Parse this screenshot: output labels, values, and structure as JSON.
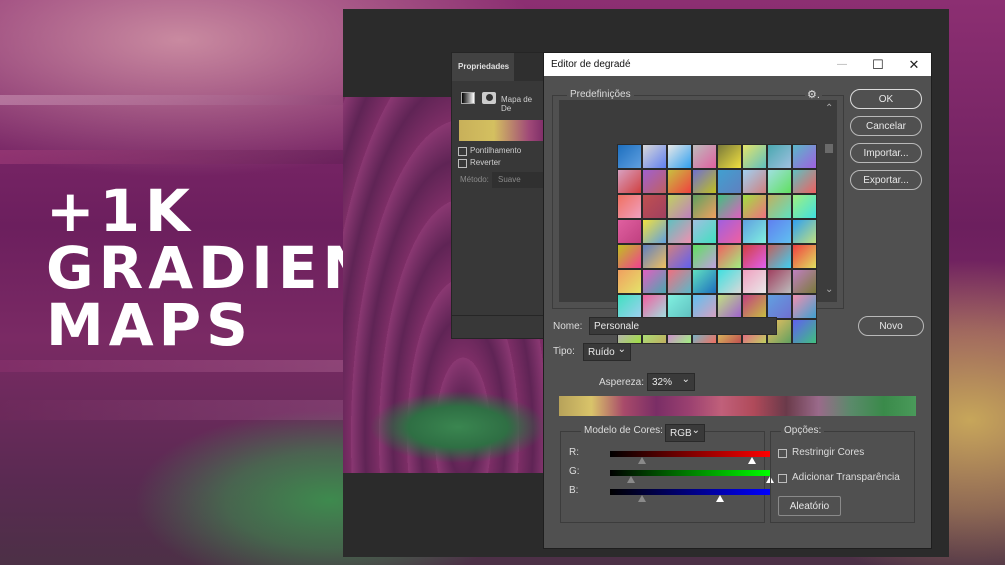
{
  "title_lines": [
    "+1K",
    "GRADIENT",
    "MAPS"
  ],
  "properties_panel": {
    "tab": "Propriedades",
    "map_label": "Mapa de De",
    "dither": "Pontilhamento",
    "reverse": "Reverter",
    "method_label": "Método:",
    "method_value": "Suave"
  },
  "dialog": {
    "title": "Editor de degradé",
    "min_glyph": "—",
    "max_glyph": "☐",
    "close_glyph": "✕",
    "presets_label": "Predefinições",
    "gear_glyph": "⚙.",
    "scroll_up": "⌃",
    "scroll_down": "⌄",
    "buttons": {
      "ok": "OK",
      "cancel": "Cancelar",
      "import": "Importar...",
      "export": "Exportar...",
      "new": "Novo"
    },
    "name_label": "Nome:",
    "name_value": "Personale",
    "type_label": "Tipo:",
    "type_value": "Ruído",
    "roughness_label": "Aspereza:",
    "roughness_value": "32%",
    "color_model_label": "Modelo de Cores:",
    "color_model_value": "RGB",
    "chevron": "⌄",
    "channels": [
      {
        "label": "R:",
        "color": "#ff0000",
        "low": 0.2,
        "high": 0.89
      },
      {
        "label": "G:",
        "color": "#00ff00",
        "low": 0.13,
        "high": 1.0
      },
      {
        "label": "B:",
        "color": "#0000ff",
        "low": 0.2,
        "high": 0.69
      }
    ],
    "options_label": "Opções:",
    "restrict_colors": "Restringir Cores",
    "add_transparency": "Adicionar Transparência",
    "randomize": "Aleatório"
  },
  "preset_colors": [
    [
      "#1d6fbf",
      "#d8d8d8",
      "#e8e8e8",
      "#bcbcbc",
      "#7a7a3a",
      "#e4e46a",
      "#4aa8b0",
      "#5ab8c8"
    ],
    [
      "#d8a0c0",
      "#a060d0",
      "#c8c040",
      "#7070d0",
      "#40a0d0",
      "#a0d0f0",
      "#a0e0e0",
      "#60c0c0"
    ],
    [
      "#f07060",
      "#c05050",
      "#c0d060",
      "#60a060",
      "#40c080",
      "#a0e040",
      "#c0b060",
      "#a0f080"
    ],
    [
      "#e060a0",
      "#f0e040",
      "#60c0c0",
      "#a0c0e0",
      "#a060e0",
      "#60a0e0",
      "#6080f0",
      "#30a0f0"
    ],
    [
      "#c0c020",
      "#6080c0",
      "#d08080",
      "#60e060",
      "#f06060",
      "#d04040",
      "#c06060",
      "#f04040"
    ],
    [
      "#f0a060",
      "#e060c0",
      "#f07080",
      "#60e0c0",
      "#40e0e0",
      "#f0a0c0",
      "#a04060",
      "#c080c0"
    ],
    [
      "#40e0c0",
      "#f060a0",
      "#80f0e0",
      "#60c0f0",
      "#c0e080",
      "#c04080",
      "#60a0e0",
      "#f090b0"
    ],
    [
      "#c0a0e0",
      "#a0f080",
      "#e060f0",
      "#40d0f0",
      "#e0e060",
      "#f04090",
      "#f0c060",
      "#6060f0"
    ]
  ],
  "gradient_preview_colors": [
    "#b7a25a",
    "#d9c46a",
    "#a84a6a",
    "#7a2e66",
    "#9a4070",
    "#c0607a",
    "#b04a5a",
    "#6a3a4a",
    "#9a6a8a",
    "#5a8a6a",
    "#3a8a4a",
    "#4a9a5a"
  ]
}
